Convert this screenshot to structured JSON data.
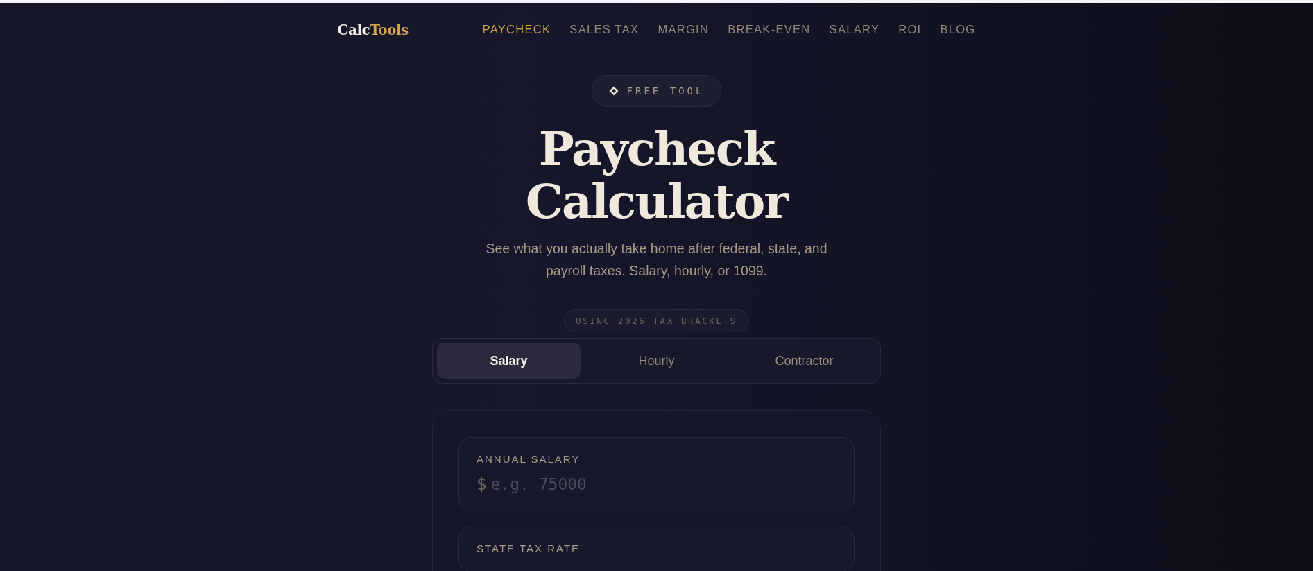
{
  "logo": {
    "first": "Calc",
    "second": "Tools"
  },
  "nav": [
    {
      "label": "PAYCHECK",
      "selected": true
    },
    {
      "label": "SALES TAX",
      "selected": false
    },
    {
      "label": "MARGIN",
      "selected": false
    },
    {
      "label": "BREAK-EVEN",
      "selected": false
    },
    {
      "label": "SALARY",
      "selected": false
    },
    {
      "label": "ROI",
      "selected": false
    },
    {
      "label": "BLOG",
      "selected": false
    }
  ],
  "badge": "FREE TOOL",
  "title": [
    "Paycheck",
    "Calculator"
  ],
  "subtitle": "See what you actually take home after federal, state, and payroll taxes. Salary, hourly, or 1099.",
  "bracket_pill": "USING 2026 TAX BRACKETS",
  "tabs": [
    {
      "label": "Salary",
      "selected": true
    },
    {
      "label": "Hourly",
      "selected": false
    },
    {
      "label": "Contractor",
      "selected": false
    }
  ],
  "fields": [
    {
      "label": "ANNUAL SALARY",
      "prefix": "$",
      "placeholder": "e.g. 75000"
    },
    {
      "label": "STATE TAX RATE"
    }
  ]
}
